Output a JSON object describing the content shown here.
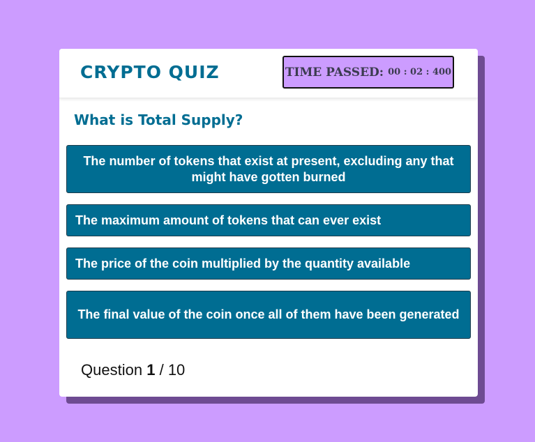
{
  "header": {
    "title": "CRYPTO QUIZ",
    "timer_label": "TIME PASSED:",
    "timer_value": "00 : 02 : 400"
  },
  "question": {
    "text": "What is Total Supply?"
  },
  "answers": [
    {
      "label": "The number of tokens that exist at present, excluding any that might have gotten burned"
    },
    {
      "label": "The maximum amount of tokens that can ever exist"
    },
    {
      "label": "The price of the coin multiplied by the quantity available"
    },
    {
      "label": "The final value of the coin once all of them have been generated"
    }
  ],
  "footer": {
    "prefix": "Question",
    "current": "1",
    "separator": "/",
    "total": "10"
  },
  "colors": {
    "background": "#cc9cff",
    "accent": "#006d92",
    "shadow": "#6e4b92"
  }
}
